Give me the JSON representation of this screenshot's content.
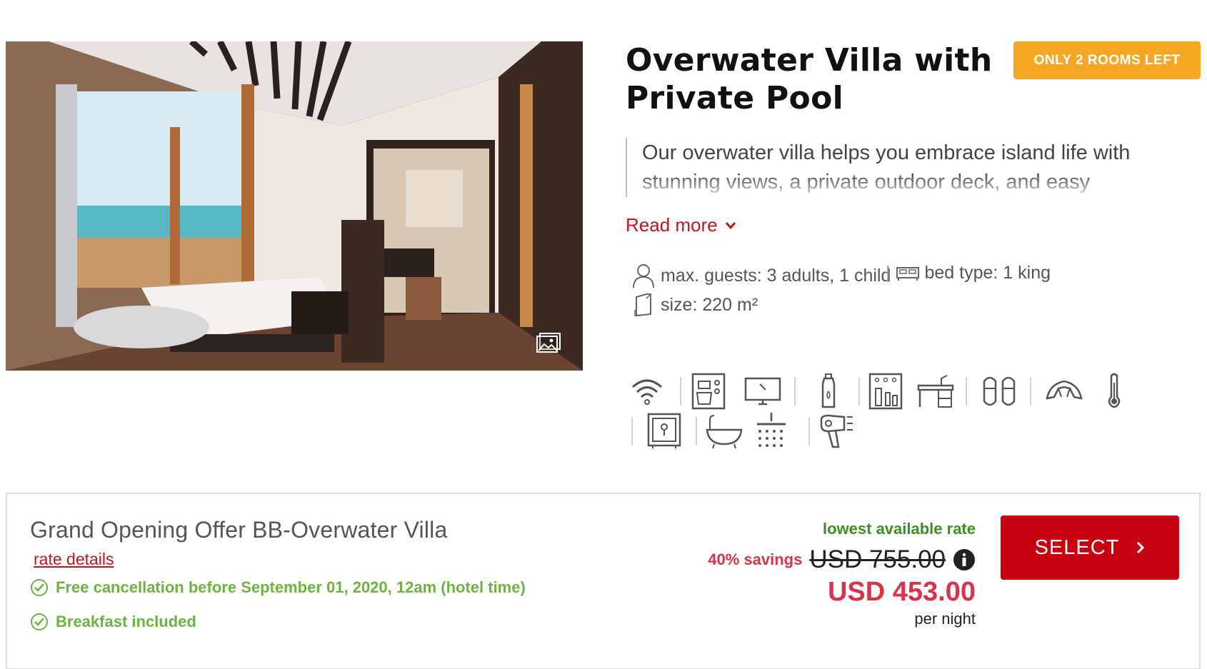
{
  "room": {
    "title": "Overwater Villa with Private Pool",
    "availability_badge": "ONLY 2 ROOMS LEFT",
    "description": "Our overwater villa helps you embrace island life with stunning views, a private outdoor deck, and easy",
    "read_more_label": "Read more",
    "facts": {
      "guests": "max. guests: 3 adults, 1 child",
      "separator": "|",
      "bed": "bed type: 1 king",
      "size": "size: 220 m²"
    },
    "amenity_icons": [
      "wifi-icon",
      "coffee-machine-icon",
      "television-icon",
      "water-bottle-icon",
      "minibar-icon",
      "desk-icon",
      "slippers-icon",
      "croissant-icon",
      "thermometer-icon",
      "safe-icon",
      "bathtub-icon",
      "shower-icon",
      "hair-dryer-icon"
    ]
  },
  "rate": {
    "name": "Grand Opening Offer BB-Overwater Villa",
    "details_link": "rate details",
    "perks": [
      "Free cancellation before September 01, 2020, 12am (hotel time)",
      "Breakfast included"
    ],
    "lowest_label": "lowest available rate",
    "savings": "40% savings",
    "original_price": "USD 755.00",
    "price": "USD 453.00",
    "per_night": "per night",
    "select_label": "SELECT"
  },
  "colors": {
    "accent_red": "#c6000f",
    "price_red": "#d9334a",
    "badge_orange": "#f5a623",
    "perk_green": "#6db33f",
    "lowest_green": "#3f8f1f"
  }
}
